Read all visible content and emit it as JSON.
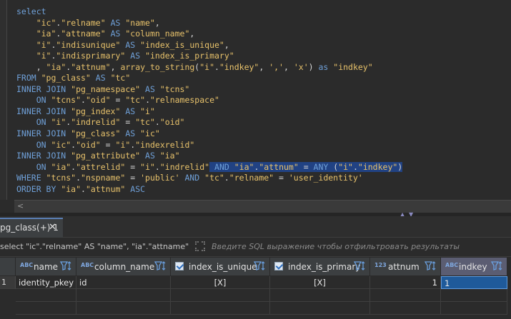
{
  "editor": {
    "lines": [
      [
        {
          "t": "select",
          "c": "kw"
        }
      ],
      [
        {
          "t": "    ",
          "c": "op"
        },
        {
          "t": "\"ic\"",
          "c": "id"
        },
        {
          "t": ".",
          "c": "op"
        },
        {
          "t": "\"relname\"",
          "c": "id"
        },
        {
          "t": " AS ",
          "c": "kw"
        },
        {
          "t": "\"name\"",
          "c": "id"
        },
        {
          "t": ",",
          "c": "op"
        }
      ],
      [
        {
          "t": "    ",
          "c": "op"
        },
        {
          "t": "\"ia\"",
          "c": "id"
        },
        {
          "t": ".",
          "c": "op"
        },
        {
          "t": "\"attname\"",
          "c": "id"
        },
        {
          "t": " AS ",
          "c": "kw"
        },
        {
          "t": "\"column_name\"",
          "c": "id"
        },
        {
          "t": ",",
          "c": "op"
        }
      ],
      [
        {
          "t": "    ",
          "c": "op"
        },
        {
          "t": "\"i\"",
          "c": "id"
        },
        {
          "t": ".",
          "c": "op"
        },
        {
          "t": "\"indisunique\"",
          "c": "id"
        },
        {
          "t": " AS ",
          "c": "kw"
        },
        {
          "t": "\"index_is_unique\"",
          "c": "id"
        },
        {
          "t": ",",
          "c": "op"
        }
      ],
      [
        {
          "t": "    ",
          "c": "op"
        },
        {
          "t": "\"i\"",
          "c": "id"
        },
        {
          "t": ".",
          "c": "op"
        },
        {
          "t": "\"indisprimary\"",
          "c": "id"
        },
        {
          "t": " AS ",
          "c": "kw"
        },
        {
          "t": "\"index_is_primary\"",
          "c": "id"
        }
      ],
      [
        {
          "t": "    , ",
          "c": "op"
        },
        {
          "t": "\"ia\"",
          "c": "id"
        },
        {
          "t": ".",
          "c": "op"
        },
        {
          "t": "\"attnum\"",
          "c": "id"
        },
        {
          "t": ", ",
          "c": "op"
        },
        {
          "t": "array_to_string",
          "c": "id"
        },
        {
          "t": "(",
          "c": "op"
        },
        {
          "t": "\"i\"",
          "c": "id"
        },
        {
          "t": ".",
          "c": "op"
        },
        {
          "t": "\"indkey\"",
          "c": "id"
        },
        {
          "t": ", ",
          "c": "op"
        },
        {
          "t": "','",
          "c": "str"
        },
        {
          "t": ", ",
          "c": "op"
        },
        {
          "t": "'x'",
          "c": "str"
        },
        {
          "t": ") ",
          "c": "op"
        },
        {
          "t": "as ",
          "c": "kw"
        },
        {
          "t": "\"indkey\"",
          "c": "id"
        }
      ],
      [
        {
          "t": "FROM ",
          "c": "kw"
        },
        {
          "t": "\"pg_class\"",
          "c": "id"
        },
        {
          "t": " AS ",
          "c": "kw"
        },
        {
          "t": "\"tc\"",
          "c": "id"
        }
      ],
      [
        {
          "t": "INNER JOIN ",
          "c": "kw"
        },
        {
          "t": "\"pg_namespace\"",
          "c": "id"
        },
        {
          "t": " AS ",
          "c": "kw"
        },
        {
          "t": "\"tcns\"",
          "c": "id"
        }
      ],
      [
        {
          "t": "    ON ",
          "c": "kw"
        },
        {
          "t": "\"tcns\"",
          "c": "id"
        },
        {
          "t": ".",
          "c": "op"
        },
        {
          "t": "\"oid\"",
          "c": "id"
        },
        {
          "t": " = ",
          "c": "op"
        },
        {
          "t": "\"tc\"",
          "c": "id"
        },
        {
          "t": ".",
          "c": "op"
        },
        {
          "t": "\"relnamespace\"",
          "c": "id"
        }
      ],
      [
        {
          "t": "INNER JOIN ",
          "c": "kw"
        },
        {
          "t": "\"pg_index\"",
          "c": "id"
        },
        {
          "t": " AS ",
          "c": "kw"
        },
        {
          "t": "\"i\"",
          "c": "id"
        }
      ],
      [
        {
          "t": "    ON ",
          "c": "kw"
        },
        {
          "t": "\"i\"",
          "c": "id"
        },
        {
          "t": ".",
          "c": "op"
        },
        {
          "t": "\"indrelid\"",
          "c": "id"
        },
        {
          "t": " = ",
          "c": "op"
        },
        {
          "t": "\"tc\"",
          "c": "id"
        },
        {
          "t": ".",
          "c": "op"
        },
        {
          "t": "\"oid\"",
          "c": "id"
        }
      ],
      [
        {
          "t": "INNER JOIN ",
          "c": "kw"
        },
        {
          "t": "\"pg_class\"",
          "c": "id"
        },
        {
          "t": " AS ",
          "c": "kw"
        },
        {
          "t": "\"ic\"",
          "c": "id"
        }
      ],
      [
        {
          "t": "    ON ",
          "c": "kw"
        },
        {
          "t": "\"ic\"",
          "c": "id"
        },
        {
          "t": ".",
          "c": "op"
        },
        {
          "t": "\"oid\"",
          "c": "id"
        },
        {
          "t": " = ",
          "c": "op"
        },
        {
          "t": "\"i\"",
          "c": "id"
        },
        {
          "t": ".",
          "c": "op"
        },
        {
          "t": "\"indexrelid\"",
          "c": "id"
        }
      ],
      [
        {
          "t": "INNER JOIN ",
          "c": "kw"
        },
        {
          "t": "\"pg_attribute\"",
          "c": "id"
        },
        {
          "t": " AS ",
          "c": "kw"
        },
        {
          "t": "\"ia\"",
          "c": "id"
        }
      ],
      [
        {
          "t": "    ON ",
          "c": "kw"
        },
        {
          "t": "\"ia\"",
          "c": "id"
        },
        {
          "t": ".",
          "c": "op"
        },
        {
          "t": "\"attrelid\"",
          "c": "id"
        },
        {
          "t": " = ",
          "c": "op"
        },
        {
          "t": "\"i\"",
          "c": "id"
        },
        {
          "t": ".",
          "c": "op"
        },
        {
          "t": "\"indrelid\"",
          "c": "id"
        },
        {
          "t": " AND ",
          "c": "kw",
          "s": 1
        },
        {
          "t": "\"ia\"",
          "c": "id",
          "s": 1
        },
        {
          "t": ".",
          "c": "op",
          "s": 1
        },
        {
          "t": "\"attnum\"",
          "c": "id",
          "s": 1
        },
        {
          "t": " = ",
          "c": "op",
          "s": 1
        },
        {
          "t": "ANY",
          "c": "kw",
          "s": 1
        },
        {
          "t": " (",
          "c": "op",
          "s": 1
        },
        {
          "t": "\"i\"",
          "c": "id",
          "s": 1
        },
        {
          "t": ".",
          "c": "op",
          "s": 1
        },
        {
          "t": "\"indkey\"",
          "c": "id",
          "s": 1
        },
        {
          "t": ")",
          "c": "op",
          "s": 1
        }
      ],
      [
        {
          "t": "WHERE ",
          "c": "kw"
        },
        {
          "t": "\"tcns\"",
          "c": "id"
        },
        {
          "t": ".",
          "c": "op"
        },
        {
          "t": "\"nspname\"",
          "c": "id"
        },
        {
          "t": " = ",
          "c": "op"
        },
        {
          "t": "'public'",
          "c": "str"
        },
        {
          "t": " AND ",
          "c": "kw"
        },
        {
          "t": "\"tc\"",
          "c": "id"
        },
        {
          "t": ".",
          "c": "op"
        },
        {
          "t": "\"relname\"",
          "c": "id"
        },
        {
          "t": " = ",
          "c": "op"
        },
        {
          "t": "'user_identity'",
          "c": "str"
        }
      ],
      [
        {
          "t": "ORDER BY ",
          "c": "kw"
        },
        {
          "t": "\"ia\"",
          "c": "id"
        },
        {
          "t": ".",
          "c": "op"
        },
        {
          "t": "\"attnum\"",
          "c": "id"
        },
        {
          "t": " ASC",
          "c": "kw"
        }
      ]
    ]
  },
  "scroll": {
    "left_arrow": "<"
  },
  "results_tab": {
    "label": "pg_class(+) 1",
    "close": "✕"
  },
  "filter": {
    "query_text": "select \"ic\".\"relname\" AS \"name\", \"ia\".\"attname\" AS \"",
    "placeholder": "Введите SQL выражение чтобы отфильтровать результаты"
  },
  "grid": {
    "columns": [
      {
        "label": "name",
        "type_icon": "ABC"
      },
      {
        "label": "column_name",
        "type_icon": "ABC"
      },
      {
        "label": "index_is_unique",
        "type_icon": "check"
      },
      {
        "label": "index_is_primary",
        "type_icon": "check"
      },
      {
        "label": "attnum",
        "type_icon": "123"
      },
      {
        "label": "indkey",
        "type_icon": "ABC"
      }
    ],
    "rows": [
      {
        "num": "1",
        "cells": [
          "identity_pkey",
          "id",
          "[X]",
          "[X]",
          "1",
          "1"
        ]
      }
    ]
  },
  "colors": {
    "keyword": "#6fa0d8",
    "identifier": "#e8c26b",
    "selection": "#214283",
    "active_header": "#5b5d72"
  }
}
